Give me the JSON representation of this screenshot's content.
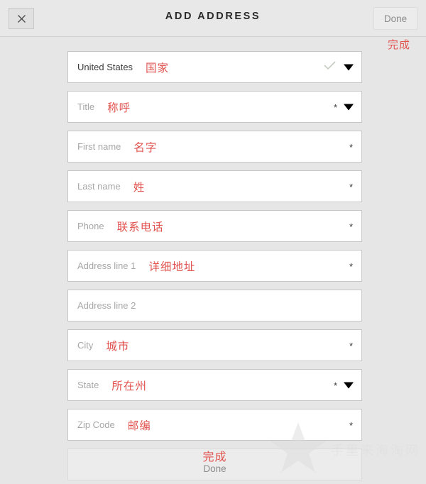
{
  "header": {
    "close_icon": "close-icon",
    "title": "ADD ADDRESS",
    "done_label": "Done",
    "done_annotation": "完成"
  },
  "form": {
    "fields": [
      {
        "label": "United States",
        "annotation": "国家",
        "filled": true,
        "required": false,
        "dropdown": true,
        "checkmark": true,
        "name": "country-field"
      },
      {
        "label": "Title",
        "annotation": "称呼",
        "filled": false,
        "required": true,
        "dropdown": true,
        "checkmark": false,
        "name": "title-field"
      },
      {
        "label": "First name",
        "annotation": "名字",
        "filled": false,
        "required": true,
        "dropdown": false,
        "checkmark": false,
        "name": "first-name-field"
      },
      {
        "label": "Last name",
        "annotation": "姓",
        "filled": false,
        "required": true,
        "dropdown": false,
        "checkmark": false,
        "name": "last-name-field"
      },
      {
        "label": "Phone",
        "annotation": "联系电话",
        "filled": false,
        "required": true,
        "dropdown": false,
        "checkmark": false,
        "name": "phone-field"
      },
      {
        "label": "Address line 1",
        "annotation": "详细地址",
        "filled": false,
        "required": true,
        "dropdown": false,
        "checkmark": false,
        "name": "address-line-1-field"
      },
      {
        "label": "Address line 2",
        "annotation": "",
        "filled": false,
        "required": false,
        "dropdown": false,
        "checkmark": false,
        "name": "address-line-2-field"
      },
      {
        "label": "City",
        "annotation": "城市",
        "filled": false,
        "required": true,
        "dropdown": false,
        "checkmark": false,
        "name": "city-field"
      },
      {
        "label": "State",
        "annotation": "所在州",
        "filled": false,
        "required": true,
        "dropdown": true,
        "checkmark": false,
        "name": "state-field"
      },
      {
        "label": "Zip Code",
        "annotation": "邮编",
        "filled": false,
        "required": true,
        "dropdown": false,
        "checkmark": false,
        "name": "zip-code-field"
      }
    ],
    "required_marker": "*"
  },
  "footer": {
    "done_label": "Done",
    "done_annotation": "完成"
  },
  "watermark": {
    "text": "手里来海淘网"
  },
  "colors": {
    "annotation_red": "#e2534f",
    "page_background": "#e7e6e6",
    "field_background": "#ffffff",
    "placeholder_text": "#a8a7a7"
  }
}
